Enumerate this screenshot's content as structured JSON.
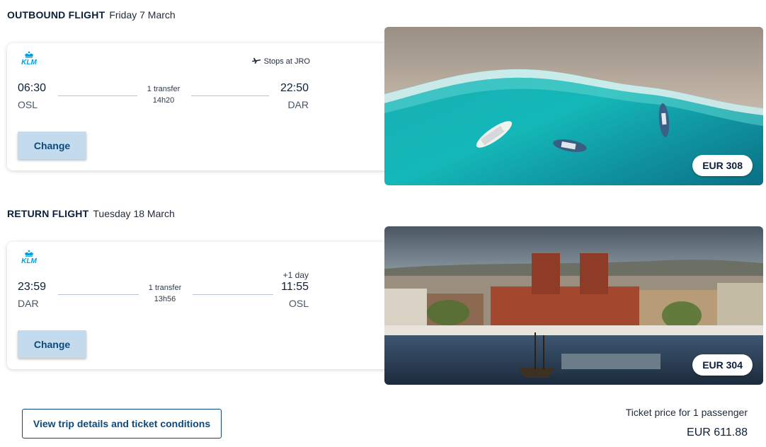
{
  "outbound": {
    "label": "OUTBOUND FLIGHT",
    "date": "Friday 7 March",
    "airline": "KLM",
    "stops_text": "Stops at JRO",
    "dep_time": "06:30",
    "dep_code": "OSL",
    "arr_time": "22:50",
    "arr_code": "DAR",
    "transfers": "1 transfer",
    "duration": "14h20",
    "change_label": "Change",
    "price": "EUR 308",
    "image_icon": "beach-boats-photo"
  },
  "return": {
    "label": "RETURN FLIGHT",
    "date": "Tuesday 18 March",
    "airline": "KLM",
    "dep_time": "23:59",
    "dep_code": "DAR",
    "arr_time": "11:55",
    "arr_code": "OSL",
    "day_offset": "+1 day",
    "transfers": "1 transfer",
    "duration": "13h56",
    "change_label": "Change",
    "price": "EUR 304",
    "image_icon": "oslo-city-hall-photo"
  },
  "footer": {
    "details_label": "View trip details and ticket conditions",
    "ticket_label": "Ticket price for 1 passenger",
    "total": "EUR 611.88"
  },
  "colors": {
    "navy": "#0b1f3a",
    "brand_blue": "#00a1de",
    "button_fill": "#c4dbee",
    "button_text": "#0c4a7d"
  }
}
